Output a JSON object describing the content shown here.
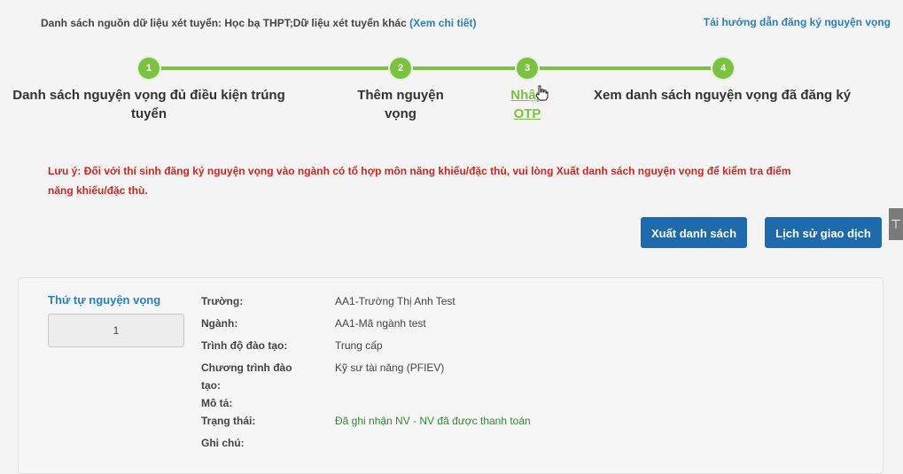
{
  "header": {
    "source_text": "Danh sách nguồn dữ liệu xét tuyển: Học bạ THPT;Dữ liệu xét tuyển khác",
    "view_detail_label": "(Xem chi tiết)",
    "guide_link": "Tải hướng dẫn đăng ký nguyện vọng"
  },
  "steps": [
    {
      "number": "1",
      "label": "Danh sách nguyện vọng đủ điều kiện trúng tuyển"
    },
    {
      "number": "2",
      "label": "Thêm nguyện vọng"
    },
    {
      "number": "3",
      "label": "Nhập OTP"
    },
    {
      "number": "4",
      "label": "Xem danh sách nguyện vọng đã đăng ký"
    }
  ],
  "active_step": 3,
  "warning": "Lưu ý: Đối với thí sinh đăng ký nguyện vọng vào ngành có tổ hợp môn năng khiếu/đặc thù, vui lòng Xuất danh sách nguyện vọng để kiểm tra điểm năng khiếu/đặc thù.",
  "buttons": {
    "export_list": "Xuất danh sách",
    "transaction_history": "Lịch sử giao dịch"
  },
  "edge_control": "⊤",
  "record": {
    "order_title": "Thứ tự nguyện vọng",
    "order_value": "1",
    "fields": [
      {
        "label": "Trường:",
        "value": "AA1-Trường Thị Anh Test"
      },
      {
        "label": "Ngành:",
        "value": "AA1-Mã ngành test"
      },
      {
        "label": "Trình độ đào tạo:",
        "value": "Trung cấp"
      },
      {
        "label": "Chương trình đào tạo:",
        "value": "Kỹ sư tài năng (PFIEV)"
      },
      {
        "label": "Mô tả:",
        "value": ""
      },
      {
        "label": "Trạng thái:",
        "value": "Đã ghi nhận NV - NV đã được thanh toán"
      },
      {
        "label": "Ghi chú:",
        "value": ""
      }
    ]
  },
  "colors": {
    "accent_green": "#7cc242",
    "primary_blue": "#1e6aad",
    "link_blue": "#2a7fbf",
    "warning_red": "#d0261f",
    "status_green": "#2e8b2e"
  }
}
